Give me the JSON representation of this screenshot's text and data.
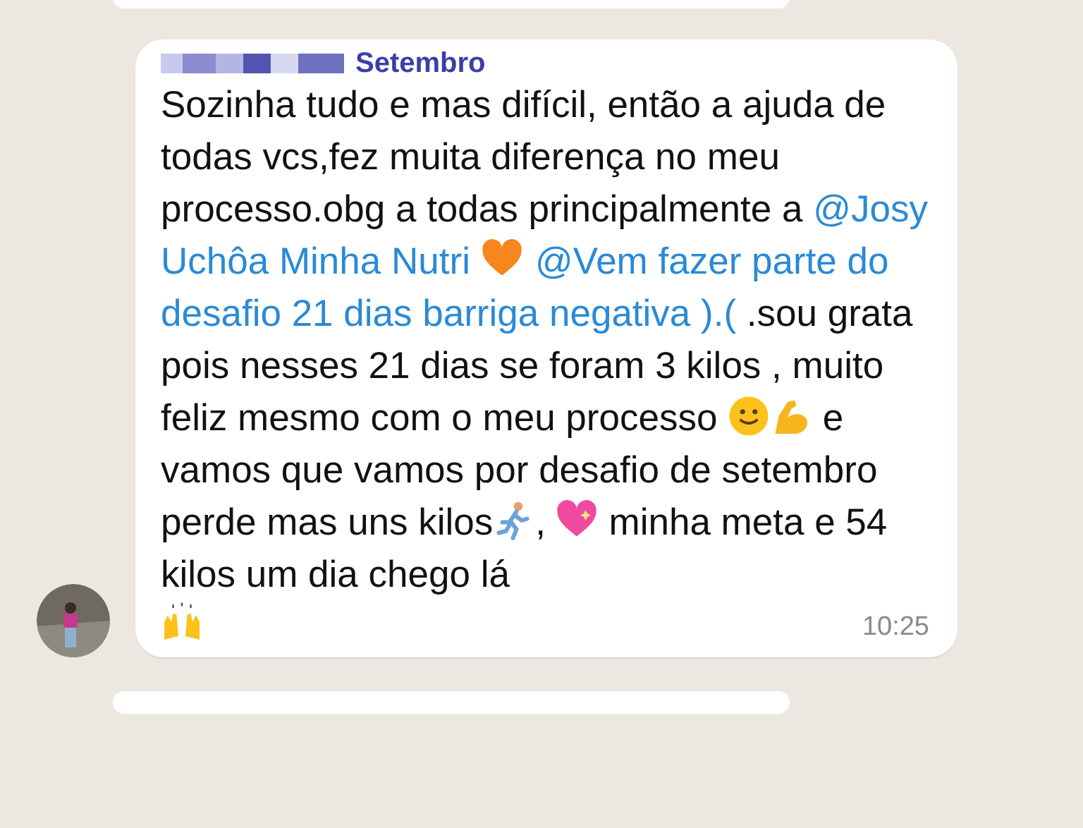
{
  "message": {
    "sender": "Setembro",
    "sender_redacted": true,
    "segments": [
      {
        "kind": "text",
        "text": "Sozinha tudo e mas difícil, então a ajuda de todas vcs,fez muita diferença no meu processo.obg a todas principalmente a "
      },
      {
        "kind": "mention",
        "text": "@Josy Uchôa Minha Nutri"
      },
      {
        "kind": "orange-heart"
      },
      {
        "kind": "mention",
        "text": "@Vem fazer parte do desafio 21 dias barriga negativa ).("
      },
      {
        "kind": "text",
        "text": " .sou grata pois nesses 21 dias se foram 3 kilos , muito feliz mesmo com o meu processo "
      },
      {
        "kind": "smiley"
      },
      {
        "kind": "flexed-arm"
      },
      {
        "kind": "text",
        "text": " e vamos que vamos por desafio de setembro perde mas uns kilos"
      },
      {
        "kind": "runner"
      },
      {
        "kind": "text",
        "text": ", "
      },
      {
        "kind": "sparkle-heart"
      },
      {
        "kind": "text",
        "text": " minha meta e 54 kilos um dia chego lá"
      },
      {
        "kind": "break"
      },
      {
        "kind": "raised-hands"
      }
    ],
    "time": "10:25"
  }
}
